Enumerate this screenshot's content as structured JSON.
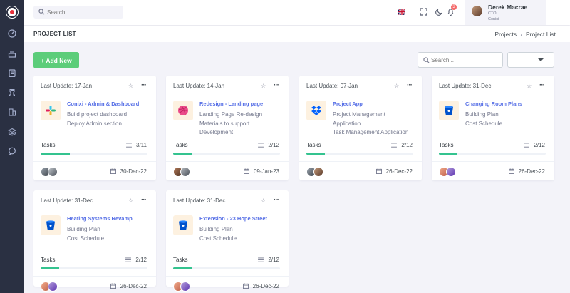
{
  "header": {
    "search_placeholder": "Search...",
    "user": {
      "name": "Derek Macrae",
      "role": "CTO",
      "org": "Conixi"
    },
    "notification_count": "3"
  },
  "page": {
    "title": "PROJECT LIST",
    "breadcrumb": [
      "Projects",
      "Project List"
    ]
  },
  "toolbar": {
    "add_label": "+ Add New",
    "search_placeholder": "Search...",
    "select_value": ""
  },
  "colors": {
    "accent": "#556ee6",
    "success": "#34c38f",
    "add_button": "#5ccd7a",
    "sidebar": "#2a3042"
  },
  "cards": [
    {
      "date": "Last Update: 17-Jan",
      "icon": "slack-icon",
      "title": "Conixi - Admin & Dashboard",
      "desc": [
        "Build project dashboard",
        "Deploy Admin section"
      ],
      "tasks_label": "Tasks",
      "tasks": "3/11",
      "progress": 0.27,
      "due": "30-Dec-22"
    },
    {
      "date": "Last Update: 14-Jan",
      "icon": "dribbble-icon",
      "title": "Redesign - Landing page",
      "desc": [
        "Landing Page Re-design",
        "Materials to support",
        "Development"
      ],
      "tasks_label": "Tasks",
      "tasks": "2/12",
      "progress": 0.17,
      "due": "09-Jan-23"
    },
    {
      "date": "Last Update: 07-Jan",
      "icon": "dropbox-icon",
      "title": "Project App",
      "desc": [
        "Project Management",
        "Application",
        "Task Management Application"
      ],
      "tasks_label": "Tasks",
      "tasks": "2/12",
      "progress": 0.17,
      "due": "26-Dec-22"
    },
    {
      "date": "Last Update: 31-Dec",
      "icon": "bitbucket-icon",
      "title": "Changing Room Plans",
      "desc": [
        "Building Plan",
        "Cost Schedule"
      ],
      "tasks_label": "Tasks",
      "tasks": "2/12",
      "progress": 0.17,
      "due": "26-Dec-22"
    },
    {
      "date": "Last Update: 31-Dec",
      "icon": "bitbucket-icon",
      "title": "Heating Systems Revamp",
      "desc": [
        "Building Plan",
        "Cost Schedule"
      ],
      "tasks_label": "Tasks",
      "tasks": "2/12",
      "progress": 0.17,
      "due": "26-Dec-22"
    },
    {
      "date": "Last Update: 31-Dec",
      "icon": "bitbucket-icon",
      "title": "Extension - 23 Hope Street",
      "desc": [
        "Building Plan",
        "Cost Schedule"
      ],
      "tasks_label": "Tasks",
      "tasks": "2/12",
      "progress": 0.17,
      "due": "26-Dec-22"
    }
  ]
}
